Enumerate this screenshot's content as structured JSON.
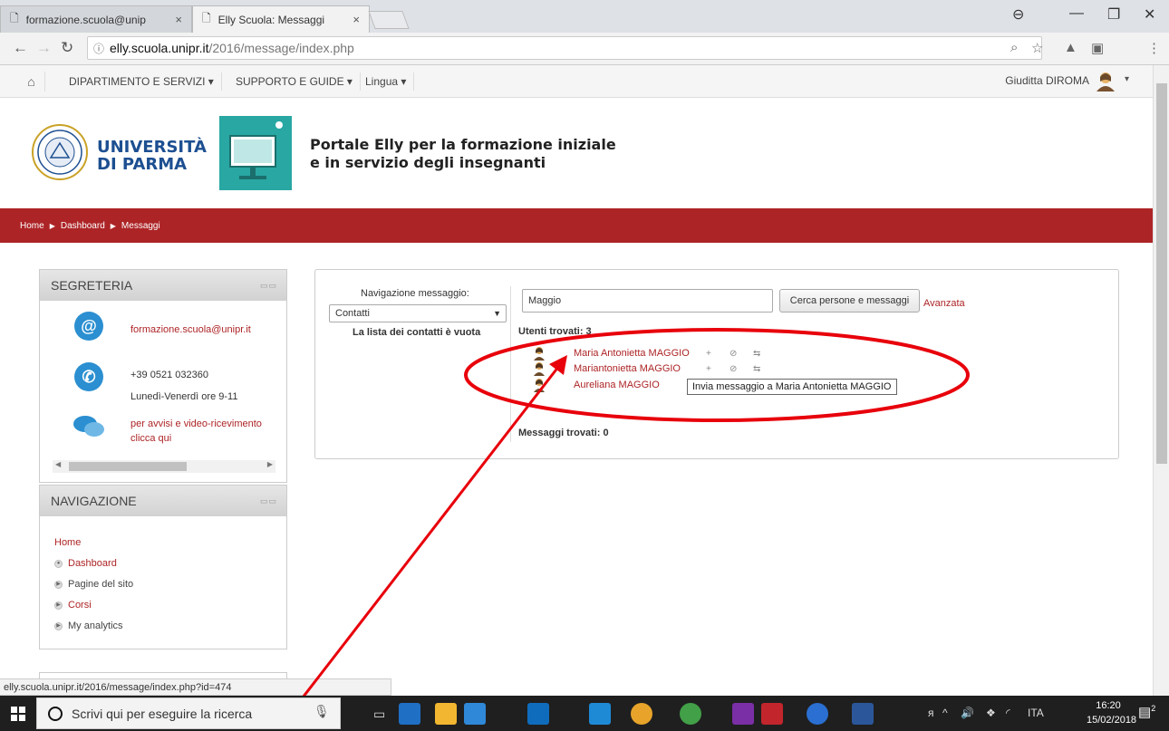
{
  "browser": {
    "tabs": [
      {
        "title": "formazione.scuola@unip",
        "close": "×"
      },
      {
        "title": "Elly Scuola: Messaggi",
        "close": "×"
      }
    ],
    "url_host": "elly.scuola.unipr.it",
    "url_path": "/2016/message/index.php",
    "status_url": "elly.scuola.unipr.it/2016/message/index.php?id=474"
  },
  "sitenav": {
    "menus": [
      "DIPARTIMENTO E SERVIZI ▾",
      "SUPPORTO E GUIDE ▾",
      "Lingua ▾"
    ],
    "user": "Giuditta DIROMA",
    "caret": "▾"
  },
  "header": {
    "uni_line1": "UNIVERSITÀ",
    "uni_line2": "DI PARMA",
    "portal_line1": "Portale Elly per la formazione iniziale",
    "portal_line2": "e in servizio degli insegnanti"
  },
  "breadcrumb": {
    "items": [
      "Home",
      "Dashboard",
      "Messaggi"
    ],
    "separator": "▶"
  },
  "segreteria": {
    "title": "SEGRETERIA",
    "email": "formazione.scuola@unipr.it",
    "phone": "+39 0521 032360",
    "hours": "Lunedì-Venerdì ore 9-11",
    "video_line1": "per avvisi e video-ricevimento",
    "video_line2": "clicca qui"
  },
  "navigazione": {
    "title": "NAVIGAZIONE",
    "home": "Home",
    "items": [
      "Dashboard",
      "Pagine del sito",
      "Corsi",
      "My analytics"
    ]
  },
  "messages": {
    "nav_label": "Navigazione messaggio:",
    "select_value": "Contatti",
    "empty_contacts": "La lista dei contatti è vuota",
    "search_value": "Maggio",
    "search_button": "Cerca persone e messaggi",
    "advanced": "Avanzata",
    "users_found": "Utenti trovati: 3",
    "users": [
      "Maria Antonietta MAGGIO",
      "Mariantonietta MAGGIO",
      "Aureliana MAGGIO"
    ],
    "tooltip": "Invia messaggio a Maria Antonietta MAGGIO",
    "messages_found": "Messaggi trovati: 0"
  },
  "taskbar": {
    "search_placeholder": "Scrivi qui per eseguire la ricerca",
    "lang": "ITA",
    "time": "16:20",
    "date": "15/02/2018",
    "notifications": "2"
  },
  "colors": {
    "brand_red": "#ad2426",
    "uni_blue": "#1d4f91",
    "annotation": "#e8000b"
  }
}
